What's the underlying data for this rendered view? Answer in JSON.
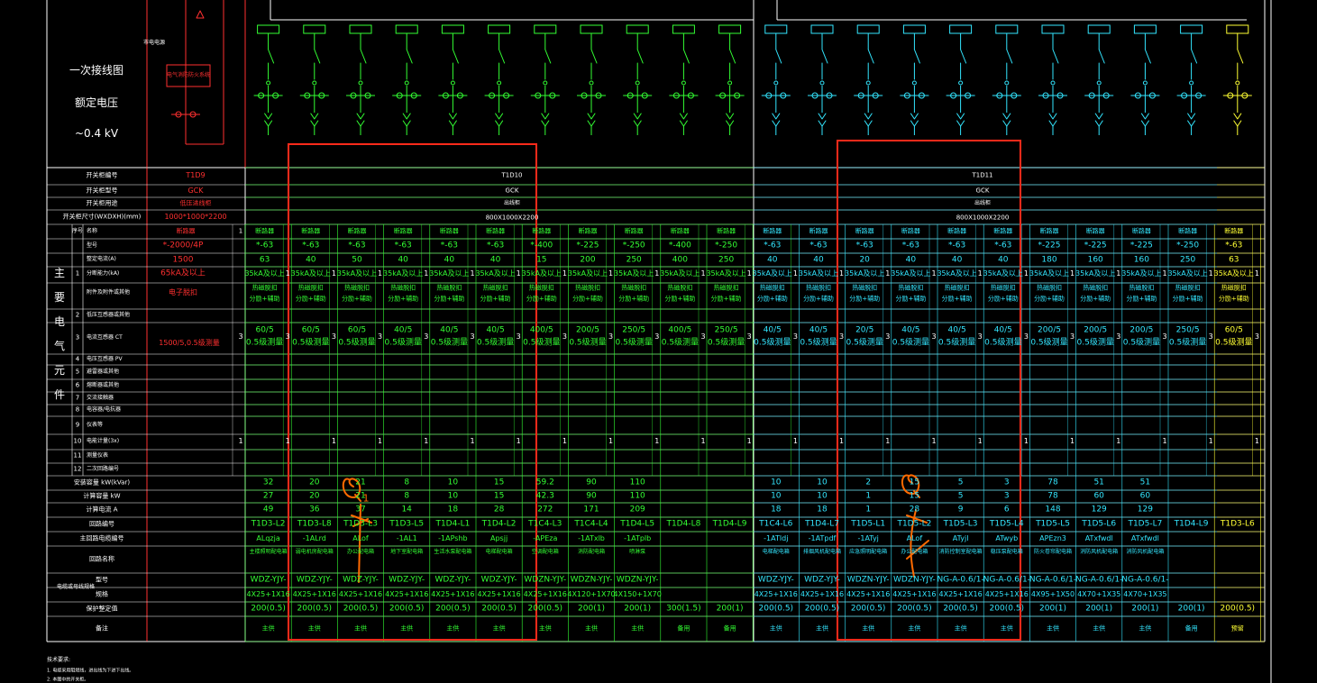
{
  "diagram": {
    "primary_title": "一次接线图",
    "rated_voltage_label": "额定电压",
    "voltage": "~0.4 kV",
    "main_components_vertical": "主要电气元件",
    "notes_title": "技术要求:",
    "notes": [
      "1. 电缆采用阻燃线，进出线为下进下出线。",
      "2. 本图中的开关柜。"
    ],
    "left_panel": {
      "label": "市电电源",
      "box_label": "电气消防防火系统"
    },
    "row_labels": {
      "cabinet_no": "开关柜编号",
      "cabinet_model": "开关柜型号",
      "cabinet_use": "开关柜用途",
      "cabinet_size": "开关柜尺寸(WXDXH)(mm)",
      "seq": "序号",
      "name": "名称",
      "model": "型号",
      "rated_current": "整定电流(A)",
      "breaking": "分断能力(kA)",
      "accessory": "附件及附件或其他",
      "r2": "低压互感器或其他",
      "ct": "电流互感器 CT",
      "pt": "电压互感器 PV",
      "r5": "避雷器或其他",
      "r6": "熔断器或其他",
      "r7": "交流接触器",
      "r8": "电容器/电抗器",
      "r9": "仪表等",
      "r10": "电能计量(3x)",
      "r11": "测量仪表",
      "r12": "二次回路编号",
      "install_cap": "安装容量 kW(kVar)",
      "calc_cap": "计算容量 kW",
      "calc_current": "计算电流 A",
      "loop_no": "回路编号",
      "cable_no": "主回路电缆编号",
      "load_name": "回路名称",
      "cable_model": "型号",
      "cable_spec": "规格",
      "cable_group": "电缆或母线规格",
      "protection": "保护整定值",
      "remark": "备注"
    },
    "cabinets": {
      "left": {
        "no": "T1D9",
        "model": "GCK",
        "use": "低压进线柜",
        "size": "1000*1000*2200"
      },
      "mid": {
        "no": "T1D10",
        "model": "GCK",
        "use": "出线柜",
        "size": "800X1000X2200"
      },
      "right": {
        "no": "T1D11",
        "model": "GCK",
        "use": "出线柜",
        "size": "800X1000X2200"
      }
    },
    "incoming": {
      "name": "断路器",
      "model": "*-2000/4P",
      "rating": "1500",
      "breaking": "65kA及以上",
      "accessory": "电子脱扣",
      "ct": "1500/5,0.5级测量"
    },
    "feeder_header": {
      "name": "断路器",
      "ct_label": "CT",
      "pv_label": "PV"
    },
    "feeders": [
      {
        "model": "*-63",
        "rating": "63",
        "breaking": "35kA及以上",
        "acc": "热磁脱扣\n分励+辅助",
        "ct": "60/5\n0.5级测量",
        "inst": "32",
        "calc": "27",
        "cur": "49",
        "loop": "T1D3-L2",
        "cable": "ALqzja",
        "load": "主楼照明配电箱",
        "cm": "WDZ-YJY-",
        "cs": "4X25+1X16",
        "prot": "200(0.5)",
        "rem": "主供",
        "color": "green"
      },
      {
        "model": "*-63",
        "rating": "40",
        "breaking": "35kA及以上",
        "acc": "热磁脱扣\n分励+辅助",
        "ct": "60/5\n0.5级测量",
        "inst": "20",
        "calc": "20",
        "cur": "36",
        "loop": "T1D3-L8",
        "cable": "-1ALrd",
        "load": "弱电机房配电箱",
        "cm": "WDZ-YJY-",
        "cs": "4X25+1X16",
        "prot": "200(0.5)",
        "rem": "主供",
        "color": "green"
      },
      {
        "model": "*-63",
        "rating": "50",
        "breaking": "35kA及以上",
        "acc": "热磁脱扣\n分励+辅助",
        "ct": "60/5\n0.5级测量",
        "inst": "21",
        "calc": "21",
        "cur": "37",
        "loop": "T1D3-L3",
        "cable": "ALof",
        "load": "办公配电箱",
        "cm": "WDZ-YJY-",
        "cs": "4X25+1X16",
        "prot": "200(0.5)",
        "rem": "主供",
        "color": "green"
      },
      {
        "model": "*-63",
        "rating": "40",
        "breaking": "35kA及以上",
        "acc": "热磁脱扣\n分励+辅助",
        "ct": "40/5\n0.5级测量",
        "inst": "8",
        "calc": "8",
        "cur": "14",
        "loop": "T1D3-L5",
        "cable": "-1AL1",
        "load": "地下室配电箱",
        "cm": "WDZ-YJY-",
        "cs": "4X25+1X16",
        "prot": "200(0.5)",
        "rem": "主供",
        "color": "green"
      },
      {
        "model": "*-63",
        "rating": "40",
        "breaking": "35kA及以上",
        "acc": "热磁脱扣\n分励+辅助",
        "ct": "40/5\n0.5级测量",
        "inst": "10",
        "calc": "10",
        "cur": "18",
        "loop": "T1D4-L1",
        "cable": "-1APshb",
        "load": "生活水泵配电箱",
        "cm": "WDZ-YJY-",
        "cs": "4X25+1X16",
        "prot": "200(0.5)",
        "rem": "主供",
        "color": "green"
      },
      {
        "model": "*-63",
        "rating": "40",
        "breaking": "35kA及以上",
        "acc": "热磁脱扣\n分励+辅助",
        "ct": "40/5\n0.5级测量",
        "inst": "15",
        "calc": "15",
        "cur": "28",
        "loop": "T1D4-L2",
        "cable": "Apsjj",
        "load": "电梯配电箱",
        "cm": "WDZ-YJY-",
        "cs": "4X25+1X16",
        "prot": "200(0.5)",
        "rem": "主供",
        "color": "green"
      },
      {
        "model": "*-400",
        "rating": "15",
        "breaking": "35kA及以上",
        "acc": "热磁脱扣\n分励+辅助",
        "ct": "400/5\n0.5级测量",
        "inst": "59.2",
        "calc": "42.3",
        "cur": "272",
        "loop": "T1C4-L3",
        "cable": "-APEza",
        "load": "空调配电箱",
        "cm": "WDZN-YJY-",
        "cs": "4X25+1X16",
        "prot": "200(0.5)",
        "rem": "主供",
        "color": "green"
      },
      {
        "model": "*-225",
        "rating": "200",
        "breaking": "35kA及以上",
        "acc": "热磁脱扣\n分励+辅助",
        "ct": "200/5\n0.5级测量",
        "inst": "90",
        "calc": "90",
        "cur": "171",
        "loop": "T1C4-L4",
        "cable": "-1ATxlb",
        "load": "消防配电箱",
        "cm": "WDZN-YJY-",
        "cs": "4X120+1X70",
        "prot": "200(1)",
        "rem": "主供",
        "color": "green"
      },
      {
        "model": "*-250",
        "rating": "250",
        "breaking": "35kA及以上",
        "acc": "热磁脱扣\n分励+辅助",
        "ct": "250/5\n0.5级测量",
        "inst": "110",
        "calc": "110",
        "cur": "209",
        "loop": "T1D4-L5",
        "cable": "-1ATplb",
        "load": "喷淋泵",
        "cm": "WDZN-YJY-",
        "cs": "4X150+1X70",
        "prot": "200(1)",
        "rem": "主供",
        "color": "green"
      },
      {
        "model": "*-400",
        "rating": "400",
        "breaking": "35kA及以上",
        "acc": "热磁脱扣\n分励+辅助",
        "ct": "400/5\n0.5级测量",
        "inst": "",
        "calc": "",
        "cur": "",
        "loop": "T1D4-L8",
        "cable": "",
        "load": "",
        "cm": "",
        "cs": "",
        "prot": "300(1.5)",
        "rem": "备用",
        "color": "green"
      },
      {
        "model": "*-250",
        "rating": "250",
        "breaking": "35kA及以上",
        "acc": "热磁脱扣\n分励+辅助",
        "ct": "250/5\n0.5级测量",
        "inst": "",
        "calc": "",
        "cur": "",
        "loop": "T1D4-L9",
        "cable": "",
        "load": "",
        "cm": "",
        "cs": "",
        "prot": "200(1)",
        "rem": "备用",
        "color": "green"
      },
      {
        "model": "*-63",
        "rating": "40",
        "breaking": "35kA及以上",
        "acc": "热磁脱扣\n分励+辅助",
        "ct": "40/5\n0.5级测量",
        "inst": "10",
        "calc": "10",
        "cur": "18",
        "loop": "T1C4-L6",
        "cable": "-1ATldj",
        "load": "电梯配电箱",
        "cm": "WDZ-YJY-",
        "cs": "4X25+1X16",
        "prot": "200(0.5)",
        "rem": "主供",
        "color": "cyan"
      },
      {
        "model": "*-63",
        "rating": "40",
        "breaking": "35kA及以上",
        "acc": "热磁脱扣\n分励+辅助",
        "ct": "40/5\n0.5级测量",
        "inst": "10",
        "calc": "10",
        "cur": "18",
        "loop": "T1D4-L7",
        "cable": "-1ATpdf",
        "load": "排烟风机配电箱",
        "cm": "WDZ-YJY-",
        "cs": "4X25+1X16",
        "prot": "200(0.5)",
        "rem": "主供",
        "color": "cyan"
      },
      {
        "model": "*-63",
        "rating": "20",
        "breaking": "35kA及以上",
        "acc": "热磁脱扣\n分励+辅助",
        "ct": "20/5\n0.5级测量",
        "inst": "2",
        "calc": "1",
        "cur": "1",
        "loop": "T1D5-L1",
        "cable": "-1ATyj",
        "load": "应急照明配电箱",
        "cm": "WDZN-YJY-",
        "cs": "4X25+1X16",
        "prot": "200(0.5)",
        "rem": "主供",
        "color": "cyan"
      },
      {
        "model": "*-63",
        "rating": "40",
        "breaking": "35kA及以上",
        "acc": "热磁脱扣\n分励+辅助",
        "ct": "40/5\n0.5级测量",
        "inst": "15",
        "calc": "15",
        "cur": "28",
        "loop": "T1D5-L2",
        "cable": "ALof",
        "load": "办公配电箱",
        "cm": "WDZN-YJY-",
        "cs": "4X25+1X16",
        "prot": "200(0.5)",
        "rem": "主供",
        "color": "cyan"
      },
      {
        "model": "*-63",
        "rating": "40",
        "breaking": "35kA及以上",
        "acc": "热磁脱扣\n分励+辅助",
        "ct": "40/5\n0.5级测量",
        "inst": "5",
        "calc": "5",
        "cur": "9",
        "loop": "T1D5-L3",
        "cable": "ATyjl",
        "load": "消防控制室配电箱",
        "cm": "NG-A-0.6/1-",
        "cs": "4X25+1X16",
        "prot": "200(0.5)",
        "rem": "主供",
        "color": "cyan"
      },
      {
        "model": "*-63",
        "rating": "40",
        "breaking": "35kA及以上",
        "acc": "热磁脱扣\n分励+辅助",
        "ct": "40/5\n0.5级测量",
        "inst": "3",
        "calc": "3",
        "cur": "6",
        "loop": "T1D5-L4",
        "cable": "ATwyb",
        "load": "稳压泵配电箱",
        "cm": "NG-A-0.6/1-",
        "cs": "4X25+1X16",
        "prot": "200(0.5)",
        "rem": "主供",
        "color": "cyan"
      },
      {
        "model": "*-225",
        "rating": "180",
        "breaking": "35kA及以上",
        "acc": "热磁脱扣\n分励+辅助",
        "ct": "200/5\n0.5级测量",
        "inst": "78",
        "calc": "78",
        "cur": "148",
        "loop": "T1D5-L5",
        "cable": "APEzn3",
        "load": "防火卷帘配电箱",
        "cm": "NG-A-0.6/1-",
        "cs": "4X95+1X50",
        "prot": "200(1)",
        "rem": "主供",
        "color": "cyan"
      },
      {
        "model": "*-225",
        "rating": "160",
        "breaking": "35kA及以上",
        "acc": "热磁脱扣\n分励+辅助",
        "ct": "200/5\n0.5级测量",
        "inst": "51",
        "calc": "60",
        "cur": "129",
        "loop": "T1D5-L6",
        "cable": "ATxfwdl",
        "load": "消防风机配电箱",
        "cm": "NG-A-0.6/1-",
        "cs": "4X70+1X35",
        "prot": "200(1)",
        "rem": "主供",
        "color": "cyan"
      },
      {
        "model": "*-225",
        "rating": "160",
        "breaking": "35kA及以上",
        "acc": "热磁脱扣\n分励+辅助",
        "ct": "200/5\n0.5级测量",
        "inst": "51",
        "calc": "60",
        "cur": "129",
        "loop": "T1D5-L7",
        "cable": "ATxfwdl",
        "load": "消防风机配电箱",
        "cm": "NG-A-0.6/1-",
        "cs": "4X70+1X35",
        "prot": "200(1)",
        "rem": "主供",
        "color": "cyan"
      },
      {
        "model": "*-250",
        "rating": "250",
        "breaking": "35kA及以上",
        "acc": "热磁脱扣\n分励+辅助",
        "ct": "250/5\n0.5级测量",
        "inst": "",
        "calc": "",
        "cur": "",
        "loop": "T1D4-L9",
        "cable": "",
        "load": "",
        "cm": "",
        "cs": "",
        "prot": "200(1)",
        "rem": "备用",
        "color": "cyan"
      },
      {
        "model": "*-63",
        "rating": "63",
        "breaking": "35kA及以上",
        "acc": "热磁脱扣\n分励+辅助",
        "ct": "60/5\n0.5级测量",
        "inst": "",
        "calc": "",
        "cur": "",
        "loop": "T1D3-L6",
        "cable": "",
        "load": "",
        "cm": "",
        "cs": "",
        "prot": "200(0.5)",
        "rem": "预留",
        "color": "yellow"
      }
    ],
    "markup": {
      "q1_label": "Q1",
      "q2_label": "Q",
      "stroke_color": "#ff6a00",
      "box_color": "#ff2a1a"
    },
    "colors": {
      "green": "#33ff33",
      "cyan": "#33e6ff",
      "yellow": "#ffff33",
      "red": "#ff3030",
      "white": "#ffffff",
      "grid": "#b0b0b0"
    }
  }
}
